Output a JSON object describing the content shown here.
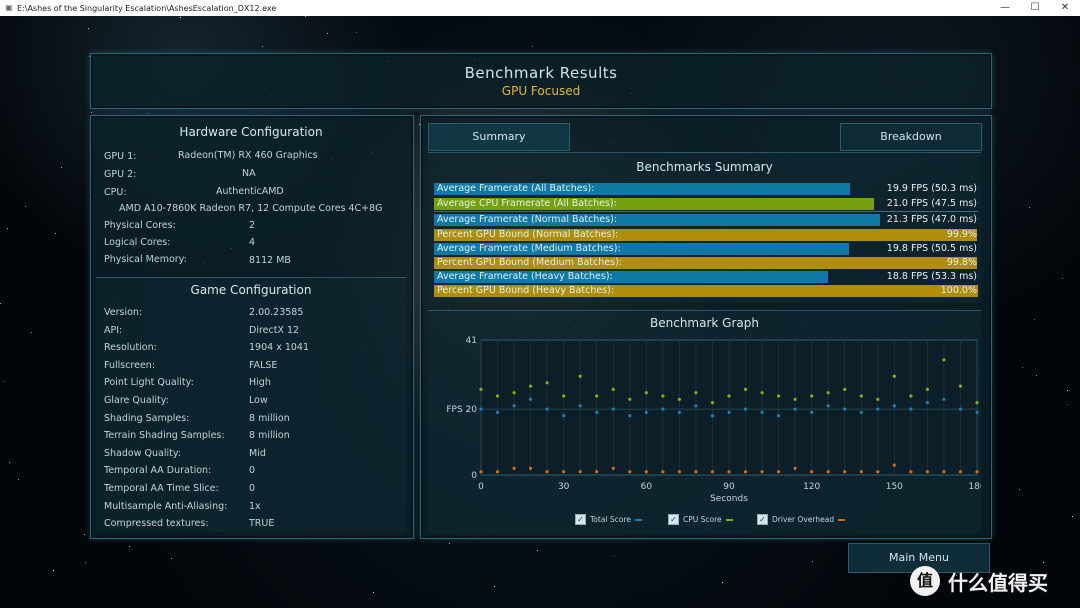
{
  "window": {
    "title": "E:\\Ashes of the Singularity Escalation\\AshesEscalation_DX12.exe",
    "controls": [
      "—",
      "☐",
      "✕"
    ]
  },
  "header": {
    "title": "Benchmark Results",
    "subtitle": "GPU Focused"
  },
  "hardware": {
    "title": "Hardware Configuration",
    "gpu1_label": "GPU 1:",
    "gpu1_value": "Radeon(TM) RX 460 Graphics",
    "gpu2_label": "GPU 2:",
    "gpu2_value": "NA",
    "cpu_label": "CPU:",
    "cpu_value": "AuthenticAMD",
    "cpu_desc": "AMD A10-7860K Radeon R7, 12 Compute Cores 4C+8G",
    "rows": [
      {
        "label": "Physical Cores:",
        "value": "2"
      },
      {
        "label": "Logical Cores:",
        "value": "4"
      },
      {
        "label": "Physical Memory:",
        "value": "8112  MB"
      }
    ]
  },
  "game": {
    "title": "Game Configuration",
    "rows": [
      {
        "label": "Version:",
        "value": "2.00.23585"
      },
      {
        "label": "API:",
        "value": "DirectX 12"
      },
      {
        "label": "Resolution:",
        "value": "1904 x 1041"
      },
      {
        "label": "Fullscreen:",
        "value": "FALSE"
      },
      {
        "label": "Point Light Quality:",
        "value": "High"
      },
      {
        "label": "Glare Quality:",
        "value": "Low"
      },
      {
        "label": "Shading Samples:",
        "value": "8 million"
      },
      {
        "label": "Terrain Shading Samples:",
        "value": "8 million"
      },
      {
        "label": "Shadow Quality:",
        "value": "Mid"
      },
      {
        "label": "Temporal AA Duration:",
        "value": "0"
      },
      {
        "label": "Temporal AA Time Slice:",
        "value": "0"
      },
      {
        "label": "Multisample Anti-Aliasing:",
        "value": "1x"
      },
      {
        "label": "Compressed textures:",
        "value": "TRUE"
      }
    ]
  },
  "tabs": {
    "summary": "Summary",
    "breakdown": "Breakdown"
  },
  "summary": {
    "title": "Benchmarks Summary",
    "bars": [
      {
        "label": "Average Framerate (All Batches):",
        "value": "19.9 FPS (50.3 ms)",
        "fill": 0.765,
        "color": "#0f79a4"
      },
      {
        "label": "Average CPU Framerate (All Batches):",
        "value": "21.0 FPS (47.5 ms)",
        "fill": 0.809,
        "color": "#76a10e"
      },
      {
        "label": "Average Framerate (Normal Batches):",
        "value": "21.3 FPS (47.0 ms)",
        "fill": 0.82,
        "color": "#0f79a4"
      },
      {
        "label": "Percent GPU Bound (Normal Batches):",
        "value": "99.9%",
        "fill": 0.999,
        "color": "#b08d0c"
      },
      {
        "label": "Average Framerate (Medium Batches):",
        "value": "19.8 FPS (50.5 ms)",
        "fill": 0.763,
        "color": "#0f79a4"
      },
      {
        "label": "Percent GPU Bound (Medium Batches):",
        "value": "99.8%",
        "fill": 0.998,
        "color": "#b08d0c"
      },
      {
        "label": "Average Framerate (Heavy Batches):",
        "value": "18.8 FPS (53.3 ms)",
        "fill": 0.724,
        "color": "#0f79a4"
      },
      {
        "label": "Percent GPU Bound (Heavy Batches):",
        "value": "100.0%",
        "fill": 1.0,
        "color": "#b08d0c"
      }
    ]
  },
  "graph": {
    "title": "Benchmark Graph",
    "legend": [
      {
        "label": "Total Score",
        "color": "#1f7fb0"
      },
      {
        "label": "CPU Score",
        "color": "#7fb020"
      },
      {
        "label": "Driver Overhead",
        "color": "#d36a14"
      }
    ]
  },
  "chart_data": {
    "type": "scatter",
    "title": "Benchmark Graph",
    "xlabel": "Seconds",
    "ylabel": "FPS",
    "xlim": [
      0,
      180
    ],
    "ylim": [
      0,
      41
    ],
    "xticks": [
      "0",
      "30",
      "60",
      "90",
      "120",
      "150",
      "180"
    ],
    "yticks": [
      {
        "label": "41",
        "value": 41
      },
      {
        "label": "FPS 20",
        "value": 20
      },
      {
        "label": "0",
        "value": 0
      }
    ],
    "series": [
      {
        "name": "Total Score",
        "color": "#1f7fb0",
        "x": [
          0,
          6,
          12,
          18,
          24,
          30,
          36,
          42,
          48,
          54,
          60,
          66,
          72,
          78,
          84,
          90,
          96,
          102,
          108,
          114,
          120,
          126,
          132,
          138,
          144,
          150,
          156,
          162,
          168,
          174,
          180
        ],
        "y": [
          20,
          19,
          21,
          23,
          20,
          18,
          21,
          19,
          20,
          18,
          19,
          20,
          19,
          21,
          18,
          19,
          20,
          19,
          18,
          20,
          19,
          21,
          20,
          19,
          20,
          21,
          20,
          22,
          23,
          20,
          19
        ]
      },
      {
        "name": "CPU Score",
        "color": "#7fb020",
        "x": [
          0,
          6,
          12,
          18,
          24,
          30,
          36,
          42,
          48,
          54,
          60,
          66,
          72,
          78,
          84,
          90,
          96,
          102,
          108,
          114,
          120,
          126,
          132,
          138,
          144,
          150,
          156,
          162,
          168,
          174,
          180
        ],
        "y": [
          26,
          24,
          25,
          27,
          28,
          24,
          30,
          24,
          26,
          23,
          25,
          24,
          23,
          25,
          22,
          24,
          26,
          25,
          24,
          23,
          24,
          25,
          26,
          24,
          23,
          30,
          24,
          26,
          35,
          27,
          22
        ]
      },
      {
        "name": "Driver Overhead",
        "color": "#d36a14",
        "x": [
          0,
          6,
          12,
          18,
          24,
          30,
          36,
          42,
          48,
          54,
          60,
          66,
          72,
          78,
          84,
          90,
          96,
          102,
          108,
          114,
          120,
          126,
          132,
          138,
          144,
          150,
          156,
          162,
          168,
          174,
          180
        ],
        "y": [
          1,
          1,
          2,
          2,
          1,
          1,
          1,
          1,
          2,
          1,
          1,
          1,
          1,
          1,
          1,
          1,
          1,
          1,
          1,
          2,
          1,
          1,
          1,
          1,
          1,
          3,
          1,
          1,
          1,
          1,
          1
        ]
      }
    ],
    "grid": true,
    "legend_position": "bottom"
  },
  "footer": {
    "main_menu": "Main Menu",
    "watermark": "什么值得买",
    "watermark_logo": "值"
  }
}
